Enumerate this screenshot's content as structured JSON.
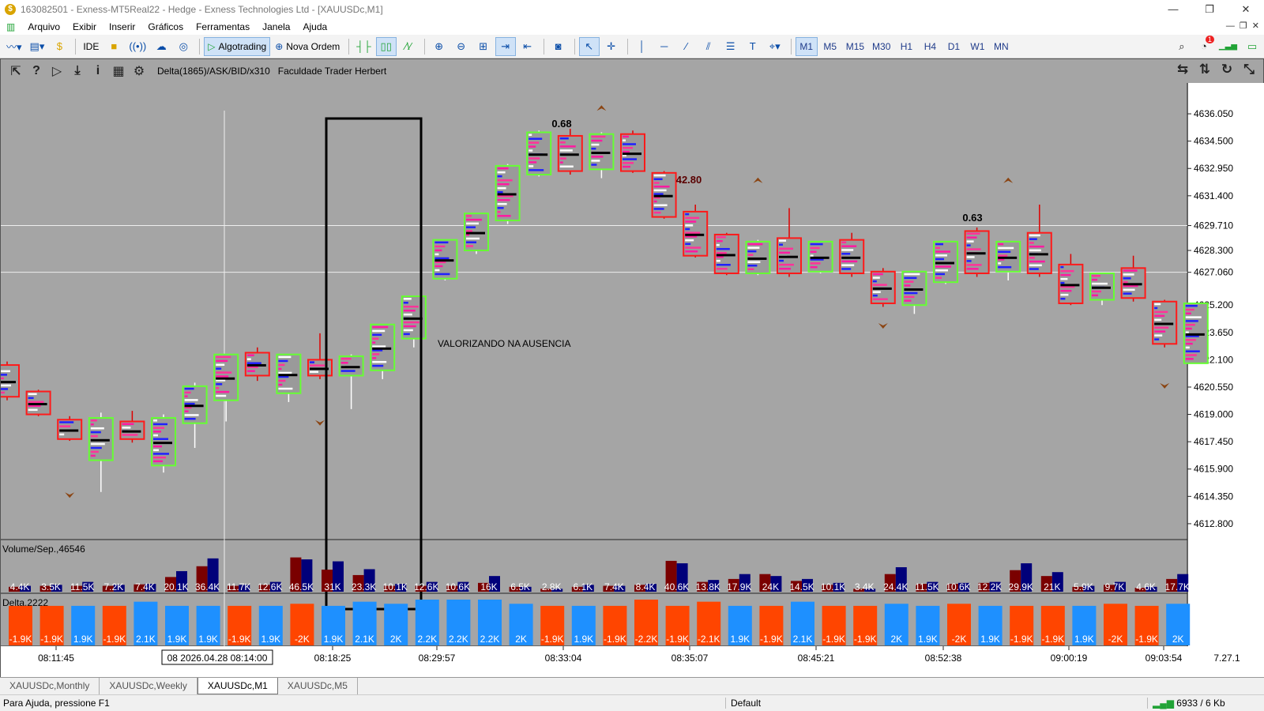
{
  "window": {
    "title": "163082501 - Exness-MT5Real22 - Hedge - Exness Technologies Ltd - [XAUUSDc,M1]",
    "minimize": "—",
    "restore": "❐",
    "close": "✕"
  },
  "menu": {
    "items": [
      "Arquivo",
      "Exibir",
      "Inserir",
      "Gráficos",
      "Ferramentas",
      "Janela",
      "Ajuda"
    ]
  },
  "toolbar": {
    "ide": "IDE",
    "algotrading": "Algotrading",
    "nova_ordem": "Nova Ordem",
    "timeframes": [
      "M1",
      "M5",
      "M15",
      "M30",
      "H1",
      "H4",
      "D1",
      "W1",
      "MN"
    ],
    "active_tf": "M1",
    "notification_count": "1"
  },
  "chart": {
    "indicator_label": "Delta(1865)/ASK/BID/x310",
    "owner_label": "Faculdade Trader Herbert",
    "annotation": "VALORIZANDO NA AUSENCIA",
    "volume_label": "Volume/Sep.,46546",
    "delta_label": "Delta,2222",
    "crosshair_time": "08 2026.04.28 08:14:00",
    "version": "7.27.1",
    "colors": {
      "background": "#a5a5a5",
      "bull_box": "#66ff33",
      "bear_box": "#ff1a1a",
      "vol_red": "#7a0000",
      "vol_blue": "#00007a",
      "delta_pos": "#1e90ff",
      "delta_neg": "#ff4500"
    }
  },
  "chart_data": {
    "type": "candlestick",
    "title": "",
    "ylim": [
      4611.9,
      4637.8
    ],
    "price_ticks": [
      "4636.050",
      "4634.500",
      "4632.950",
      "4631.400",
      "4629.710",
      "4628.300",
      "4627.060",
      "4625.200",
      "4623.650",
      "4622.100",
      "4620.550",
      "4619.000",
      "4617.450",
      "4615.900",
      "4614.350",
      "4612.800"
    ],
    "time_labels": [
      "08:11:45",
      "08:18:25",
      "08:29:57",
      "08:33:04",
      "08:35:07",
      "08:45:21",
      "08:52:38",
      "09:00:19",
      "09:03:54"
    ],
    "bar_labels": [
      {
        "index": 3,
        "text": "0.68"
      },
      {
        "index": 5,
        "text": "42.80"
      },
      {
        "index": 10,
        "text": "0.63"
      }
    ],
    "candles": [
      {
        "o": 4621.8,
        "c": 4620.0,
        "h": 4622.0,
        "l": 4619.8
      },
      {
        "o": 4620.3,
        "c": 4619.0,
        "h": 4620.4,
        "l": 4618.9
      },
      {
        "o": 4618.7,
        "c": 4617.6,
        "h": 4618.9,
        "l": 4617.5
      },
      {
        "o": 4616.4,
        "c": 4618.8,
        "h": 4619.1,
        "l": 4614.6
      },
      {
        "o": 4618.6,
        "c": 4617.6,
        "h": 4619.2,
        "l": 4617.4
      },
      {
        "o": 4616.1,
        "c": 4618.8,
        "h": 4619.0,
        "l": 4615.7
      },
      {
        "o": 4618.5,
        "c": 4620.6,
        "h": 4620.8,
        "l": 4617.1
      },
      {
        "o": 4619.8,
        "c": 4622.4,
        "h": 4622.4,
        "l": 4618.6
      },
      {
        "o": 4622.5,
        "c": 4621.2,
        "h": 4622.8,
        "l": 4620.9
      },
      {
        "o": 4620.2,
        "c": 4622.4,
        "h": 4622.4,
        "l": 4619.7
      },
      {
        "o": 4622.1,
        "c": 4621.2,
        "h": 4623.6,
        "l": 4621.0
      },
      {
        "o": 4621.2,
        "c": 4622.3,
        "h": 4622.4,
        "l": 4619.3
      },
      {
        "o": 4621.5,
        "c": 4624.1,
        "h": 4624.1,
        "l": 4621.0
      },
      {
        "o": 4623.3,
        "c": 4625.7,
        "h": 4625.7,
        "l": 4622.8
      },
      {
        "o": 4626.7,
        "c": 4628.9,
        "h": 4628.9,
        "l": 4626.6
      },
      {
        "o": 4628.3,
        "c": 4630.4,
        "h": 4630.4,
        "l": 4628.1
      },
      {
        "o": 4630.0,
        "c": 4633.1,
        "h": 4633.2,
        "l": 4629.8
      },
      {
        "o": 4632.6,
        "c": 4635.0,
        "h": 4635.1,
        "l": 4632.5
      },
      {
        "o": 4634.8,
        "c": 4632.8,
        "h": 4635.2,
        "l": 4632.6
      },
      {
        "o": 4632.9,
        "c": 4634.9,
        "h": 4635.0,
        "l": 4632.4
      },
      {
        "o": 4634.9,
        "c": 4632.8,
        "h": 4635.1,
        "l": 4632.7
      },
      {
        "o": 4632.7,
        "c": 4630.2,
        "h": 4632.8,
        "l": 4630.1
      },
      {
        "o": 4630.5,
        "c": 4628.0,
        "h": 4630.9,
        "l": 4627.9
      },
      {
        "o": 4629.2,
        "c": 4627.0,
        "h": 4629.3,
        "l": 4626.9
      },
      {
        "o": 4627.0,
        "c": 4628.8,
        "h": 4628.9,
        "l": 4626.9
      },
      {
        "o": 4629.0,
        "c": 4627.0,
        "h": 4630.7,
        "l": 4626.8
      },
      {
        "o": 4627.1,
        "c": 4628.8,
        "h": 4628.8,
        "l": 4627.0
      },
      {
        "o": 4628.9,
        "c": 4627.0,
        "h": 4629.3,
        "l": 4626.8
      },
      {
        "o": 4627.1,
        "c": 4625.3,
        "h": 4627.3,
        "l": 4625.1
      },
      {
        "o": 4625.2,
        "c": 4627.1,
        "h": 4627.1,
        "l": 4624.7
      },
      {
        "o": 4626.5,
        "c": 4628.8,
        "h": 4628.8,
        "l": 4626.4
      },
      {
        "o": 4629.4,
        "c": 4627.0,
        "h": 4629.6,
        "l": 4626.8
      },
      {
        "o": 4627.1,
        "c": 4628.8,
        "h": 4628.8,
        "l": 4626.6
      },
      {
        "o": 4629.3,
        "c": 4627.0,
        "h": 4630.9,
        "l": 4626.8
      },
      {
        "o": 4627.5,
        "c": 4625.3,
        "h": 4628.1,
        "l": 4625.2
      },
      {
        "o": 4625.5,
        "c": 4627.0,
        "h": 4627.0,
        "l": 4625.2
      },
      {
        "o": 4627.3,
        "c": 4625.6,
        "h": 4628.0,
        "l": 4625.4
      },
      {
        "o": 4625.4,
        "c": 4623.0,
        "h": 4625.5,
        "l": 4622.8
      },
      {
        "o": 4621.9,
        "c": 4625.3,
        "h": 4625.3,
        "l": 4621.6
      }
    ],
    "volume_labels": [
      "4.4K",
      "3.5K",
      "11.5K",
      "7.2K",
      "7.4K",
      "20.1K",
      "36.4K",
      "11.7K",
      "12.6K",
      "46.5K",
      "31K",
      "23.3K",
      "10.1K",
      "12.6K",
      "10.6K",
      "16K",
      "6.5K",
      "2.8K",
      "6.1K",
      "7.4K",
      "8.4K",
      "40.6K",
      "13.8K",
      "17.9K",
      "24K",
      "14.5K",
      "10.1K",
      "3.4K",
      "24.4K",
      "11.5K",
      "10.6K",
      "12.2K",
      "29.9K",
      "21K",
      "5.9K",
      "9.7K",
      "4.6K",
      "17.7K"
    ],
    "volume_red": [
      0.1,
      0.12,
      0.12,
      0.12,
      0.15,
      0.3,
      0.52,
      0.12,
      0.14,
      0.7,
      0.45,
      0.34,
      0.12,
      0.12,
      0.12,
      0.18,
      0.1,
      0.06,
      0.1,
      0.12,
      0.14,
      0.63,
      0.2,
      0.26,
      0.36,
      0.22,
      0.14,
      0.06,
      0.36,
      0.16,
      0.16,
      0.18,
      0.44,
      0.32,
      0.1,
      0.14,
      0.08,
      0.26
    ],
    "volume_blue": [
      0.12,
      0.14,
      0.2,
      0.14,
      0.16,
      0.42,
      0.68,
      0.14,
      0.2,
      0.66,
      0.62,
      0.46,
      0.16,
      0.2,
      0.2,
      0.32,
      0.1,
      0.06,
      0.14,
      0.12,
      0.16,
      0.58,
      0.24,
      0.36,
      0.32,
      0.26,
      0.18,
      0.06,
      0.5,
      0.2,
      0.18,
      0.2,
      0.58,
      0.4,
      0.12,
      0.2,
      0.1,
      0.36
    ],
    "delta_labels": [
      "-1.9K",
      "-1.9K",
      "1.9K",
      "-1.9K",
      "2.1K",
      "1.9K",
      "1.9K",
      "-1.9K",
      "1.9K",
      "-2K",
      "1.9K",
      "2.1K",
      "2K",
      "2.2K",
      "2.2K",
      "2.2K",
      "2K",
      "-1.9K",
      "1.9K",
      "-1.9K",
      "-2.2K",
      "-1.9K",
      "-2.1K",
      "1.9K",
      "-1.9K",
      "2.1K",
      "-1.9K",
      "-1.9K",
      "2K",
      "1.9K",
      "-2K",
      "1.9K",
      "-1.9K",
      "-1.9K",
      "1.9K",
      "-2K",
      "-1.9K",
      "2K"
    ],
    "delta_values": [
      -1.9,
      -1.9,
      1.9,
      -1.9,
      2.1,
      1.9,
      1.9,
      -1.9,
      1.9,
      -2,
      1.9,
      2.1,
      2,
      2.2,
      2.2,
      2.2,
      2,
      -1.9,
      1.9,
      -1.9,
      -2.2,
      -1.9,
      -2.1,
      1.9,
      -1.9,
      2.1,
      -1.9,
      -1.9,
      2,
      1.9,
      -2,
      1.9,
      -1.9,
      -1.9,
      1.9,
      -2,
      -1.9,
      2
    ]
  },
  "tabs": {
    "items": [
      "XAUUSDc,Monthly",
      "XAUUSDc,Weekly",
      "XAUUSDc,M1",
      "XAUUSDc,M5"
    ],
    "active": "XAUUSDc,M1"
  },
  "status": {
    "help": "Para Ajuda, pressione F1",
    "profile": "Default",
    "traffic": "6933 / 6 Kb"
  }
}
